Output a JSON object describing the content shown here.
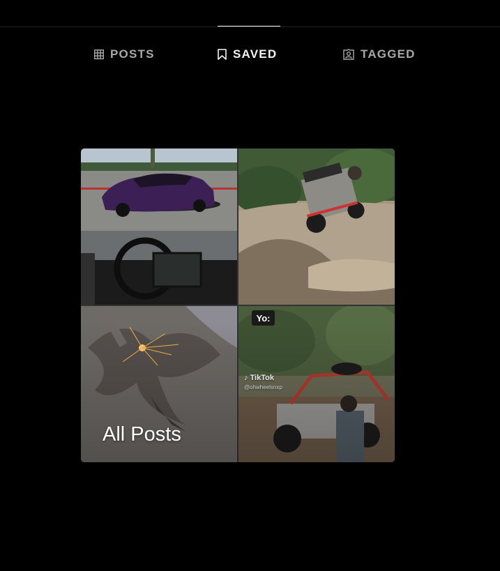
{
  "tabs": [
    {
      "label": "POSTS",
      "icon": "grid-icon",
      "active": false
    },
    {
      "label": "SAVED",
      "icon": "bookmark-icon",
      "active": true
    },
    {
      "label": "TAGGED",
      "icon": "tagged-user-icon",
      "active": false
    }
  ],
  "collection": {
    "title": "All Posts",
    "thumbnails": [
      {
        "subject": "purple sports car and car interior"
      },
      {
        "subject": "off-road buggy climbing muddy slope"
      },
      {
        "subject": "metal cutting with sparks"
      },
      {
        "subject": "off-road buggy in forest",
        "badge": "Yo:",
        "watermark": "TikTok",
        "watermark_user": "@ohwheelsnxp"
      }
    ]
  },
  "colors": {
    "background": "#000000",
    "active_text": "#f5f5f5",
    "inactive_text": "#a8a8a8",
    "divider": "#262626"
  }
}
